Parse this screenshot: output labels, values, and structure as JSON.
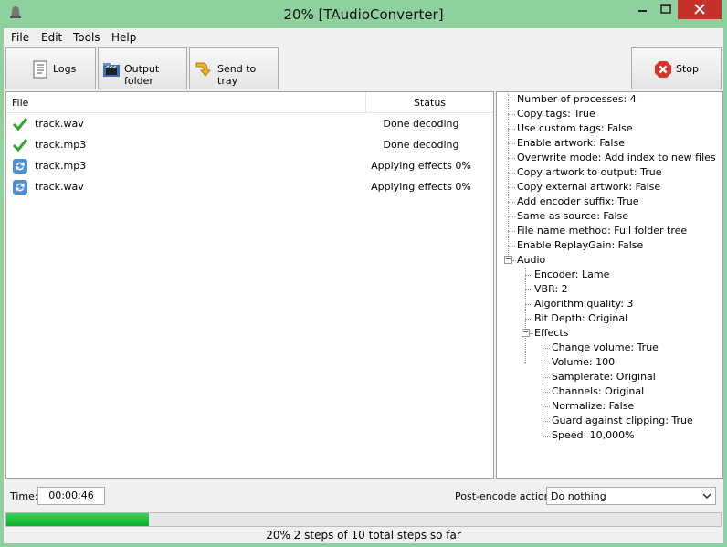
{
  "window": {
    "title": "20% [TAudioConverter]"
  },
  "menu": [
    "File",
    "Edit",
    "Tools",
    "Help"
  ],
  "toolbar": {
    "logs_label": "Logs",
    "output_folder_label": "Output folder",
    "send_to_tray_label": "Send to tray",
    "stop_label": "Stop"
  },
  "files": {
    "header_file": "File",
    "header_status": "Status",
    "rows": [
      {
        "name": "track.wav",
        "status": "Done decoding",
        "icon": "check-icon"
      },
      {
        "name": "track.mp3",
        "status": "Done decoding",
        "icon": "check-icon"
      },
      {
        "name": "track.mp3",
        "status": "Applying effects 0%",
        "icon": "refresh-icon"
      },
      {
        "name": "track.wav",
        "status": "Applying effects 0%",
        "icon": "refresh-icon"
      }
    ]
  },
  "tree": {
    "items": [
      "Number of processes: 4",
      "Copy tags: True",
      "Use custom tags: False",
      "Enable artwork: False",
      "Overwrite mode: Add index to new files",
      "Copy artwork to output: True",
      "Copy external artwork: False",
      "Add encoder suffix: True",
      "Same as source: False",
      "File name method: Full folder tree",
      "Enable ReplayGain: False"
    ],
    "audio": {
      "label": "Audio",
      "items": [
        "Encoder: Lame",
        "VBR: 2",
        "Algorithm quality: 3",
        "Bit Depth: Original"
      ],
      "effects": {
        "label": "Effects",
        "items": [
          "Change volume: True",
          "Volume: 100",
          "Samplerate: Original",
          "Channels: Original",
          "Normalize: False",
          "Guard against clipping: True",
          "Speed: 10,000%"
        ]
      }
    }
  },
  "bottom": {
    "time_label": "Time:",
    "time_value": "00:00:46",
    "post_encode_label": "Post-encode action:",
    "post_encode_value": "Do nothing",
    "progress": 0.2,
    "status_text": "20% 2 steps of 10 total steps so far"
  },
  "colors": {
    "titlebar": "#8fd19e",
    "close": "#c7312b",
    "progress": "#06b025"
  }
}
